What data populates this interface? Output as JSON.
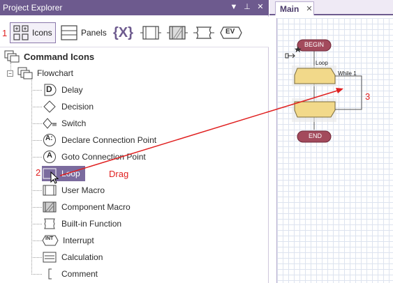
{
  "left_panel": {
    "title": "Project Explorer",
    "controls": [
      "▼",
      "⊥",
      "✕"
    ],
    "toolbar": {
      "icons_label": "Icons",
      "panels_label": "Panels",
      "variables_symbol": "{X}",
      "ev_symbol": "EV"
    },
    "annotation_1": "1",
    "tree": {
      "root_label": "Command Icons",
      "flowchart_label": "Flowchart",
      "items": [
        {
          "label": "Delay",
          "icon_text": "D"
        },
        {
          "label": "Decision"
        },
        {
          "label": "Switch"
        },
        {
          "label": "Declare Connection Point",
          "icon_text": "A:"
        },
        {
          "label": "Goto Connection Point",
          "icon_text": "A"
        },
        {
          "label": "Loop"
        },
        {
          "label": "User Macro"
        },
        {
          "label": "Component Macro"
        },
        {
          "label": "Built-in Function"
        },
        {
          "label": "Interrupt",
          "icon_text": "INT"
        },
        {
          "label": "Calculation"
        },
        {
          "label": "Comment"
        }
      ]
    },
    "annotation_2": "2",
    "drag_text": "Drag"
  },
  "main_panel": {
    "tab_label": "Main",
    "flow": {
      "begin": "BEGIN",
      "end": "END",
      "loop_label": "Loop",
      "while_label": "While 1"
    },
    "annotation_3": "3"
  },
  "colors": {
    "accent": "#6d5a8e",
    "annotation": "#e02020",
    "begin_end": "#a34a5c",
    "loop_fill": "#f2d98a"
  }
}
